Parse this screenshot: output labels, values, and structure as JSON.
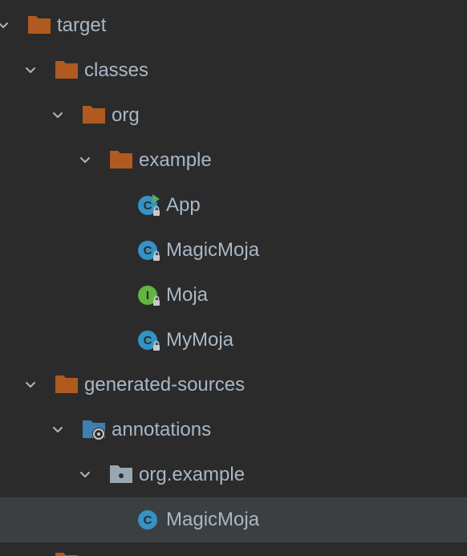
{
  "project_tree": {
    "target": {
      "label": "target",
      "icon": "folder-excluded-icon"
    },
    "classes": {
      "label": "classes",
      "icon": "folder-excluded-icon"
    },
    "org": {
      "label": "org",
      "icon": "folder-excluded-icon"
    },
    "example": {
      "label": "example",
      "icon": "folder-excluded-icon"
    },
    "app": {
      "label": "App",
      "icon": "class-runnable-locked-icon"
    },
    "magicmoja_compiled": {
      "label": "MagicMoja",
      "icon": "class-locked-icon"
    },
    "moja": {
      "label": "Moja",
      "icon": "interface-locked-icon"
    },
    "mymoja": {
      "label": "MyMoja",
      "icon": "class-locked-icon"
    },
    "generated_sources": {
      "label": "generated-sources",
      "icon": "folder-excluded-icon"
    },
    "annotations": {
      "label": "annotations",
      "icon": "generated-sources-root-icon"
    },
    "org_example": {
      "label": "org.example",
      "icon": "package-icon"
    },
    "magicmoja_generated": {
      "label": "MagicMoja",
      "icon": "class-icon"
    }
  },
  "colors": {
    "background": "#2b2b2b",
    "selected_row": "#3c3f41",
    "text": "#a9b7c6",
    "excluded_folder": "#b05a20",
    "class_badge": "#3592c4",
    "interface_badge": "#62b543",
    "run_marker": "#59a869",
    "chevron": "#a9b7c6"
  }
}
